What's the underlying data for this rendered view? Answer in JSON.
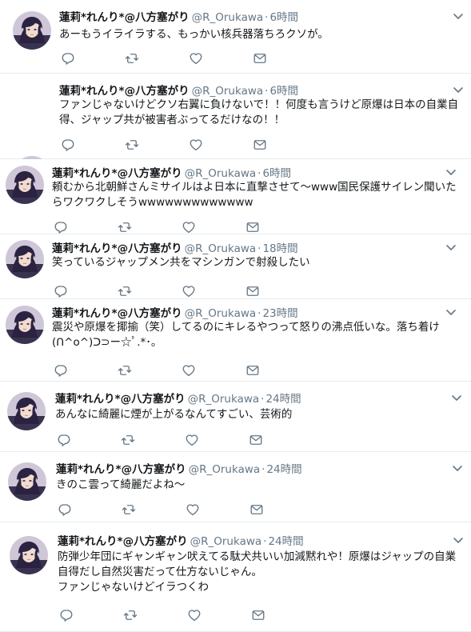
{
  "user": {
    "display_name": "蓮莉*れんり*@八方塞がり",
    "handle": "@R_Orukawa"
  },
  "separator": "·",
  "icons": {
    "reply": "reply-icon",
    "retweet": "retweet-icon",
    "like": "heart-icon",
    "message": "envelope-icon",
    "menu": "chevron-down-icon",
    "avatar": "anime-avatar"
  },
  "colors": {
    "text": "#14171a",
    "muted": "#657786",
    "border": "#e6ecf0",
    "icon": "#657786"
  },
  "tweets": [
    {
      "time": "6時間",
      "text": "あーもうイライラする、もっかい核兵器落ちろクソが。"
    },
    {
      "time": "6時間",
      "text": "ファンじゃないけどクソ右翼に負けないで！！何度も言うけど原爆は日本の自業自得、ジャップ共が被害者ぶってるだけなの！！"
    },
    {
      "time": "6時間",
      "text": "頼むから北朝鮮さんミサイルはよ日本に直撃させて〜www国民保護サイレン聞いたらワクワクしそうwwwwwwwwwwwww"
    },
    {
      "time": "18時間",
      "text": "笑っているジャップメン共をマシンガンで射殺したい"
    },
    {
      "time": "23時間",
      "text": "震災や原爆を揶揄（笑）してるのにキレるやつって怒りの沸点低いな。落ち着け(ᑎ^o^)ᑐ⊃ー☆ﾟ.*･｡"
    },
    {
      "time": "24時間",
      "text": "あんなに綺麗に煙が上がるなんてすごい、芸術的"
    },
    {
      "time": "24時間",
      "text": "きのこ雲って綺麗だよね〜"
    },
    {
      "time": "24時間",
      "text": "防弾少年団にギャンギャン吠えてる駄犬共いい加減黙れや！原爆はジャップの自業自得だし自然災害だって仕方ないじゃん。\nファンじゃないけどイラつくわ"
    }
  ]
}
